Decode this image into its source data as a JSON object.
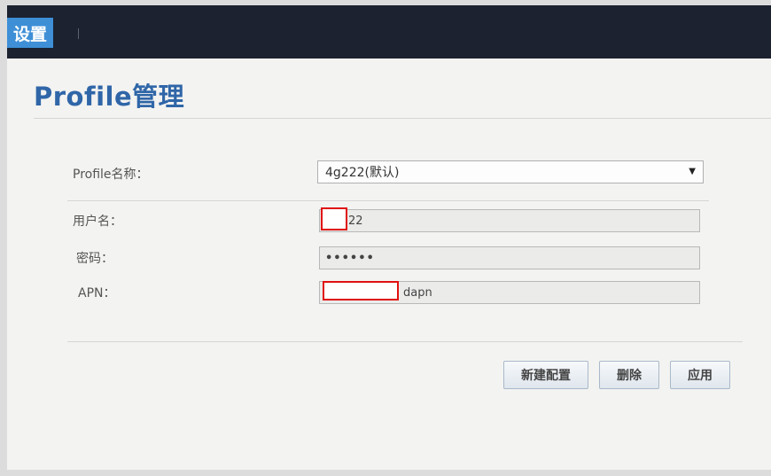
{
  "header": {
    "tab_label": "设置"
  },
  "page": {
    "title": "Profile管理"
  },
  "form": {
    "profile_label": "Profile名称：",
    "profile_selected": "4g222(默认)",
    "username_label": "用户名：",
    "username_value": "22",
    "password_label": "密码：",
    "password_value": "••••••",
    "apn_label": "APN：",
    "apn_value": "dapn"
  },
  "buttons": {
    "new_config": "新建配置",
    "delete": "删除",
    "apply": "应用"
  },
  "colors": {
    "title": "#2f66a8",
    "active_tab": "#3e8fd6",
    "redaction": "#e01010"
  }
}
